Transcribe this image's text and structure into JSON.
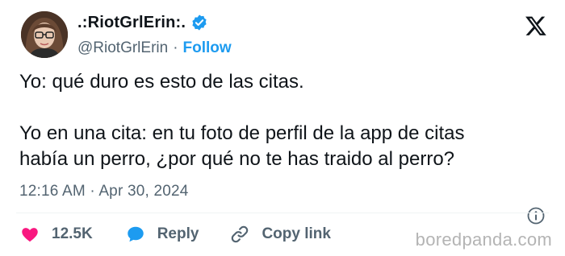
{
  "author": {
    "display_name": ".:RiotGrlErin:.",
    "handle": "@RiotGrlErin",
    "separator": "·",
    "follow_label": "Follow",
    "verified": true
  },
  "tweet": {
    "line1": "Yo: qué duro es esto de las citas.",
    "line2": "Yo en una cita: en tu foto de perfil de la app de citas",
    "line3": "había un perro, ¿por qué no te has traido al perro?",
    "timestamp": "12:16 AM · Apr 30, 2024"
  },
  "actions": {
    "like_count": "12.5K",
    "reply_label": "Reply",
    "copy_link_label": "Copy link"
  },
  "watermark": "boredpanda.com",
  "colors": {
    "accent": "#1d9bf0",
    "like": "#f91880",
    "text": "#0f1419",
    "muted": "#536471",
    "divider": "#eff3f4"
  },
  "icons": {
    "verified": "verified-badge-icon",
    "brand": "x-logo-icon",
    "info": "info-icon",
    "like": "heart-icon",
    "reply": "speech-bubble-icon",
    "copy_link": "link-icon"
  }
}
